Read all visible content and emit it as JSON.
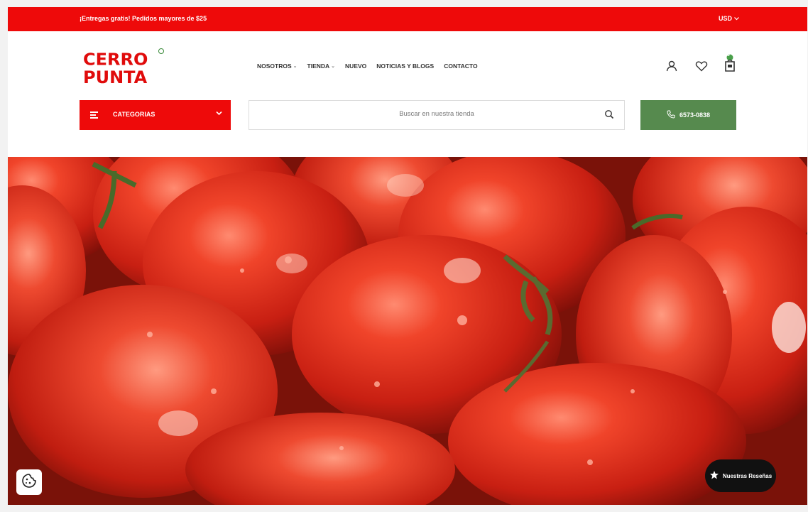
{
  "topbar": {
    "promo_text": "¡Entregas gratis! Pedidos mayores de $25",
    "currency": "USD"
  },
  "logo": {
    "line1": "CERRO",
    "line2": "PUNTA"
  },
  "nav": {
    "items": [
      {
        "label": "NOSOTROS",
        "has_dropdown": true
      },
      {
        "label": "TIENDA",
        "has_dropdown": true
      },
      {
        "label": "NUEVO",
        "has_dropdown": false
      },
      {
        "label": "NOTICIAS Y BLOGS",
        "has_dropdown": false
      },
      {
        "label": "CONTACTO",
        "has_dropdown": false
      }
    ]
  },
  "header_icons": {
    "account": "account-icon",
    "wishlist": "heart-icon",
    "cart": "cart-icon",
    "cart_count": "0"
  },
  "categories": {
    "label": "CATEGORIAS"
  },
  "search": {
    "placeholder": "Buscar en nuestra tienda"
  },
  "phone": {
    "number": "6573-0838"
  },
  "reviews_badge": {
    "label": "Nuestras Reseñas"
  },
  "colors": {
    "brand_red": "#ee0a0a",
    "brand_green": "#568a4e"
  }
}
